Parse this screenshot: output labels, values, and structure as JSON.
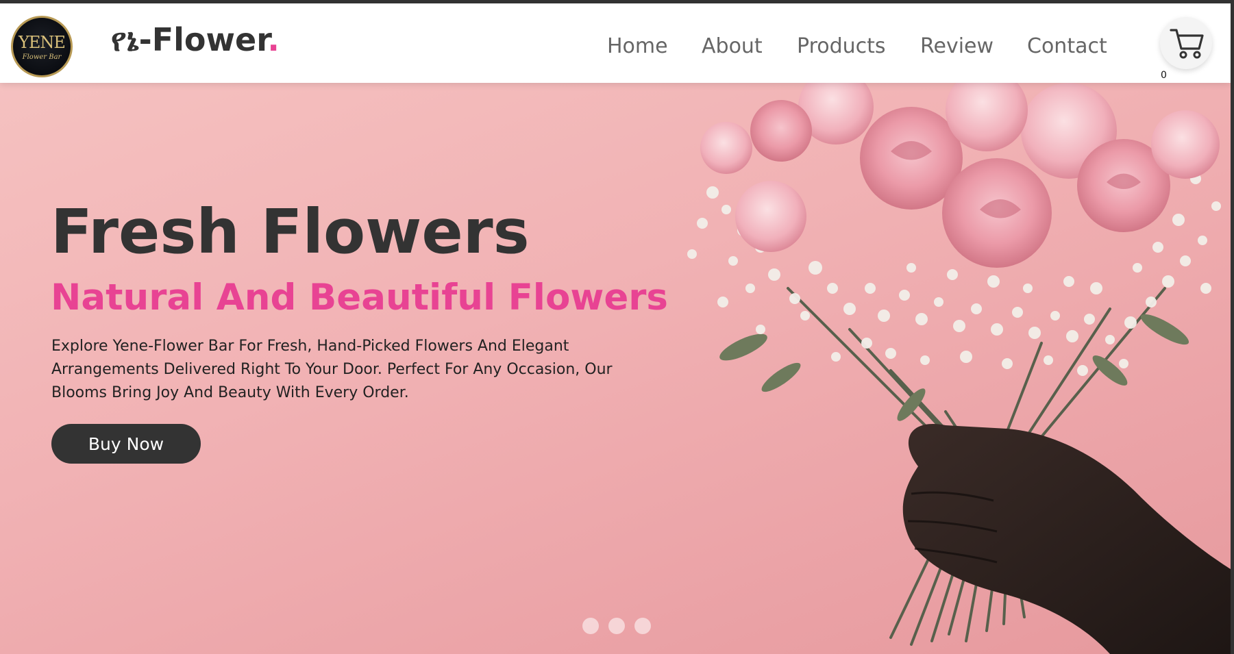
{
  "header": {
    "logo": {
      "main_text": "YENE",
      "sub_text": "Flower Bar"
    },
    "brand": {
      "prefix": "የኔ-Flower",
      "dot": "."
    },
    "nav": [
      {
        "label": "Home"
      },
      {
        "label": "About"
      },
      {
        "label": "Products"
      },
      {
        "label": "Review"
      },
      {
        "label": "Contact"
      }
    ],
    "cart": {
      "icon": "shopping-cart-icon",
      "count": "0"
    }
  },
  "hero": {
    "title": "Fresh Flowers",
    "subtitle": "Natural And Beautiful Flowers",
    "description": "Explore Yene-Flower Bar For Fresh, Hand-Picked Flowers And Elegant Arrangements Delivered Right To Your Door. Perfect For Any Occasion, Our Blooms Bring Joy And Beauty With Every Order.",
    "button_label": "Buy Now",
    "slider": {
      "slide_count": 3,
      "active_index": 0
    }
  },
  "colors": {
    "accent": "#e84393",
    "dark": "#333333",
    "nav_text": "#666666",
    "hero_bg": "#f1b2b4"
  }
}
